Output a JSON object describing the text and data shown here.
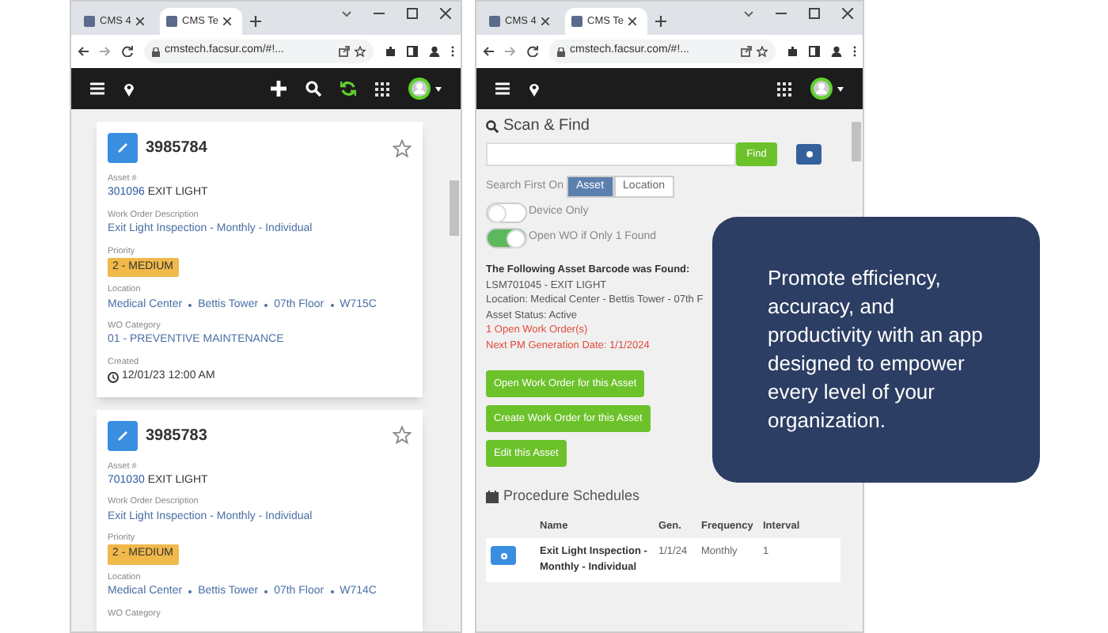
{
  "windows": [
    {
      "tabs": [
        {
          "label": "CMS 4",
          "selected": false
        },
        {
          "label": "CMS Te",
          "selected": true
        }
      ],
      "url": "cmstech.facsur.com/#!...",
      "work_orders": [
        {
          "number": "3985784",
          "starred": false,
          "fields": [
            {
              "kind": "asset",
              "label": "Asset #",
              "code": "301096",
              "asset_name": "EXIT LIGHT"
            },
            {
              "kind": "link",
              "label": "Work Order Description",
              "value": "Exit Light Inspection - Monthly - Individual"
            },
            {
              "kind": "badge",
              "label": "Priority",
              "value": "2 - MEDIUM"
            },
            {
              "kind": "path",
              "label": "Location",
              "parts": [
                "Medical Center",
                "Bettis Tower",
                "07th Floor",
                "W715C"
              ]
            },
            {
              "kind": "link",
              "label": "WO Category",
              "value": "01 - PREVENTIVE MAINTENANCE"
            },
            {
              "kind": "date",
              "label": "Created",
              "value": "12/01/23 12:00 AM"
            }
          ]
        },
        {
          "number": "3985783",
          "starred": false,
          "fields": [
            {
              "kind": "asset",
              "label": "Asset #",
              "code": "701030",
              "asset_name": "EXIT LIGHT"
            },
            {
              "kind": "link",
              "label": "Work Order Description",
              "value": "Exit Light Inspection - Monthly - Individual"
            },
            {
              "kind": "badge",
              "label": "Priority",
              "value": "2 - MEDIUM"
            },
            {
              "kind": "path",
              "label": "Location",
              "parts": [
                "Medical Center",
                "Bettis Tower",
                "07th Floor",
                "W714C"
              ]
            },
            {
              "kind": "label",
              "label": "WO Category"
            }
          ]
        }
      ]
    },
    {
      "tabs": [
        {
          "label": "CMS 4",
          "selected": false
        },
        {
          "label": "CMS Te",
          "selected": true
        }
      ],
      "url": "cmstech.facsur.com/#!...",
      "scan": {
        "title": "Scan & Find",
        "find_button": "Find",
        "search_first_label": "Search First On",
        "search_first_options": [
          {
            "label": "Asset",
            "selected": true
          },
          {
            "label": "Location",
            "selected": false
          }
        ],
        "toggles": [
          {
            "label": "Device Only",
            "on": false
          },
          {
            "label": "Open WO if Only 1 Found",
            "on": true
          }
        ],
        "result_heading": "The Following Asset Barcode was Found:",
        "result_lines": [
          {
            "kind": "normal",
            "text": "LSM701045 - EXIT LIGHT"
          },
          {
            "kind": "normal",
            "text": "Location: Medical Center - Bettis Tower - 07th F"
          },
          {
            "kind": "normal",
            "text": "Asset Status: Active"
          },
          {
            "kind": "alert",
            "text": "1 Open Work Order(s)"
          },
          {
            "kind": "alert",
            "text": "Next PM Generation Date: 1/1/2024"
          }
        ],
        "actions": [
          "Open Work Order for this Asset",
          "Create Work Order for this Asset",
          "Edit this Asset"
        ],
        "schedules_title": "Procedure Schedules",
        "columns": [
          "Name",
          "Gen.",
          "Frequency",
          "Interval"
        ],
        "rows": [
          {
            "name": "Exit Light Inspection - Monthly - Individual",
            "gen": "1/1/24",
            "frequency": "Monthly",
            "interval": "1"
          }
        ]
      }
    }
  ],
  "callout": "Promote efficiency, accuracy, and productivity with an app designed to empower every level of your organization."
}
